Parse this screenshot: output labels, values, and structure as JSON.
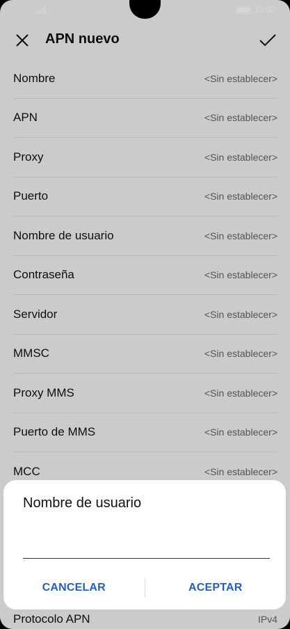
{
  "status": {
    "time": "10:00"
  },
  "header": {
    "title": "APN nuevo"
  },
  "fields": [
    {
      "label": "Nombre",
      "value": "<Sin establecer>"
    },
    {
      "label": "APN",
      "value": "<Sin establecer>"
    },
    {
      "label": "Proxy",
      "value": "<Sin establecer>"
    },
    {
      "label": "Puerto",
      "value": "<Sin establecer>"
    },
    {
      "label": "Nombre de usuario",
      "value": "<Sin establecer>"
    },
    {
      "label": "Contraseña",
      "value": "<Sin establecer>"
    },
    {
      "label": "Servidor",
      "value": "<Sin establecer>"
    },
    {
      "label": "MMSC",
      "value": "<Sin establecer>"
    },
    {
      "label": "Proxy MMS",
      "value": "<Sin establecer>"
    },
    {
      "label": "Puerto de MMS",
      "value": "<Sin establecer>"
    },
    {
      "label": "MCC",
      "value": "<Sin establecer>"
    }
  ],
  "bottom_field": {
    "label": "Protocolo APN",
    "value": "IPv4"
  },
  "dialog": {
    "title": "Nombre de usuario",
    "input_value": "",
    "cancel_label": "CANCELAR",
    "accept_label": "ACEPTAR"
  },
  "colors": {
    "accent": "#1f5fd1"
  },
  "icons": {
    "close": "close-icon",
    "confirm": "check-icon",
    "signal": "signal-icon",
    "battery": "battery-icon"
  }
}
